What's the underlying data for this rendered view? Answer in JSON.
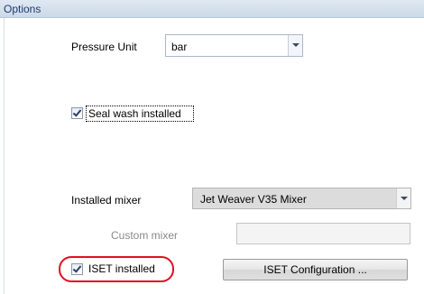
{
  "header": {
    "title": "Options"
  },
  "pressure_unit": {
    "label": "Pressure Unit",
    "value": "bar"
  },
  "seal_wash": {
    "label": "Seal wash installed",
    "checked": true
  },
  "installed_mixer": {
    "label": "Installed mixer",
    "value": "Jet Weaver V35 Mixer"
  },
  "custom_mixer": {
    "label": "Custom mixer",
    "value": "",
    "enabled": false
  },
  "iset": {
    "label": "ISET installed",
    "checked": true,
    "config_button_label": "ISET Configuration ..."
  },
  "colors": {
    "highlight": "#e01020",
    "header_text": "#1a3d6d"
  }
}
